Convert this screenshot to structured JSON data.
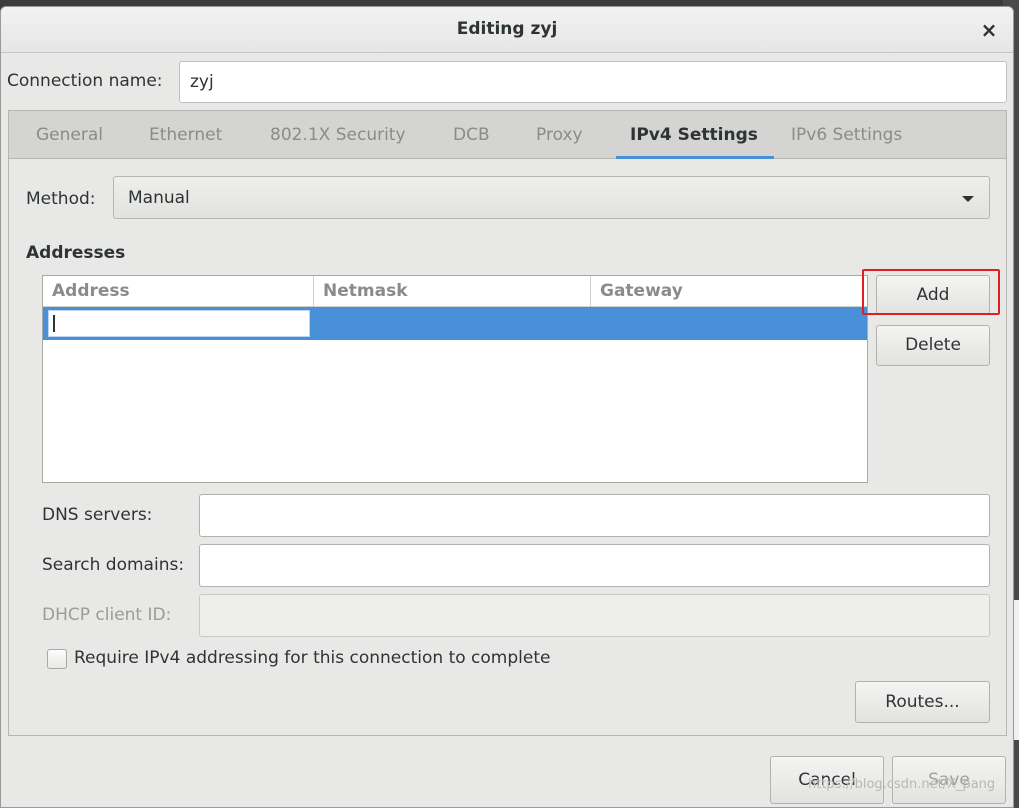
{
  "window": {
    "title": "Editing zyj",
    "close_glyph": "×",
    "close_icon": "close-icon"
  },
  "connection": {
    "label": "Connection name:",
    "value": "zyj"
  },
  "tabs": [
    {
      "label": "General",
      "active": false
    },
    {
      "label": "Ethernet",
      "active": false
    },
    {
      "label": "802.1X Security",
      "active": false
    },
    {
      "label": "DCB",
      "active": false
    },
    {
      "label": "Proxy",
      "active": false
    },
    {
      "label": "IPv4 Settings",
      "active": true
    },
    {
      "label": "IPv6 Settings",
      "active": false
    }
  ],
  "method": {
    "label": "Method:",
    "value": "Manual",
    "arrow_icon": "chevron-down-icon"
  },
  "addresses": {
    "heading": "Addresses",
    "columns": [
      "Address",
      "Netmask",
      "Gateway"
    ],
    "rows": [
      {
        "address": "",
        "netmask": "",
        "gateway": "",
        "selected": true,
        "editing": true
      }
    ],
    "add_label": "Add",
    "delete_label": "Delete"
  },
  "dns": {
    "label": "DNS servers:",
    "value": ""
  },
  "search_domains": {
    "label": "Search domains:",
    "value": ""
  },
  "dhcp_client_id": {
    "label": "DHCP client ID:",
    "value": "",
    "disabled": true
  },
  "require_ipv4": {
    "label": "Require IPv4 addressing for this connection to complete",
    "checked": false
  },
  "routes_label": "Routes...",
  "footer": {
    "cancel_label": "Cancel",
    "save_label": "Save",
    "save_disabled": true
  },
  "watermark": "https://blog.csdn.net/X_pang",
  "colors": {
    "accent": "#4a90d9",
    "highlight_annotation": "#e02020",
    "dialog_bg": "#e8e8e7"
  }
}
